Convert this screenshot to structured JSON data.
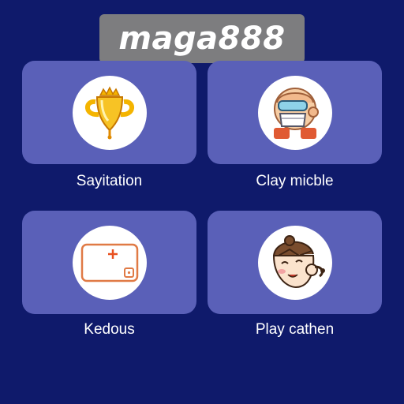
{
  "header": {
    "title": "maga888"
  },
  "tiles": [
    {
      "label": "Sayitation",
      "icon": "trophy-icon"
    },
    {
      "label": "Clay micble",
      "icon": "robot-face-icon"
    },
    {
      "label": "Kedous",
      "icon": "tablet-icon"
    },
    {
      "label": "Play cathen",
      "icon": "character-face-icon"
    }
  ],
  "colors": {
    "background": "#0f1a6b",
    "card": "#5a60b8",
    "title_badge": "#7d7d7f",
    "text": "#ffffff"
  }
}
